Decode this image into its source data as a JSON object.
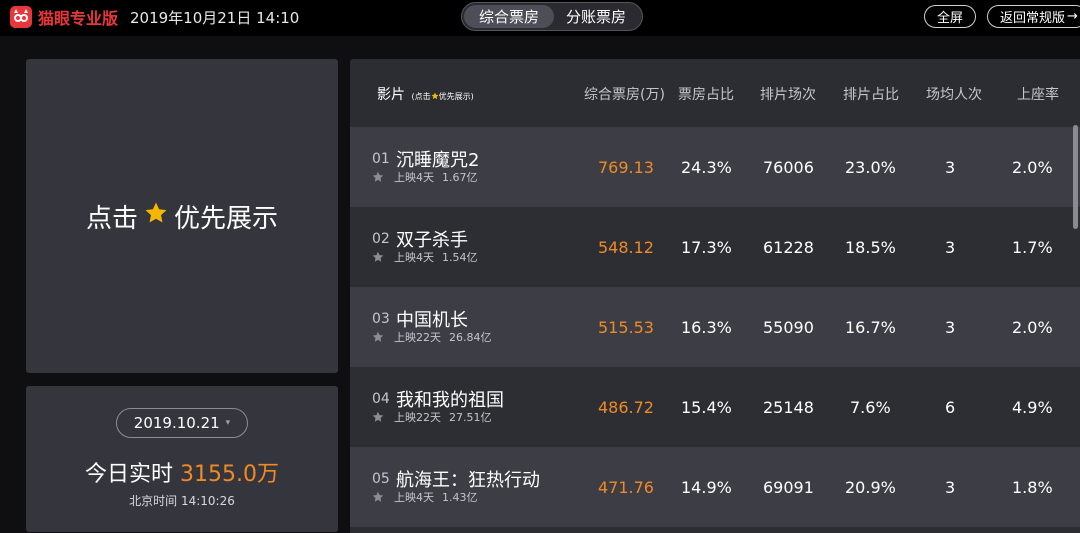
{
  "header": {
    "logo_text": "猫眼专业版",
    "datetime": "2019年10月21日 14:10",
    "tabs": [
      {
        "label": "综合票房",
        "active": true
      },
      {
        "label": "分账票房",
        "active": false
      }
    ],
    "fullscreen_label": "全屏",
    "return_label": "返回常规版",
    "return_arrow": "→"
  },
  "priority_panel": {
    "text_before": "点击",
    "text_after": "优先展示"
  },
  "today_panel": {
    "date": "2019.10.21",
    "caret": "▾",
    "label": "今日实时",
    "amount": "3155.0万",
    "beijing_time": "北京时间 14:10:26"
  },
  "table": {
    "headers": {
      "film": "影片",
      "film_hint_before": "(点击",
      "film_hint_after": "优先展示)",
      "box_office": "综合票房(万)",
      "box_share": "票房占比",
      "shows": "排片场次",
      "show_share": "排片占比",
      "avg_attendance": "场均人次",
      "occupancy": "上座率"
    },
    "rows": [
      {
        "rank": "01",
        "title": "沉睡魔咒2",
        "days": "上映4天",
        "total": "1.67亿",
        "box_office": "769.13",
        "box_share": "24.3%",
        "shows": "76006",
        "show_share": "23.0%",
        "avg_attendance": "3",
        "occupancy": "2.0%"
      },
      {
        "rank": "02",
        "title": "双子杀手",
        "days": "上映4天",
        "total": "1.54亿",
        "box_office": "548.12",
        "box_share": "17.3%",
        "shows": "61228",
        "show_share": "18.5%",
        "avg_attendance": "3",
        "occupancy": "1.7%"
      },
      {
        "rank": "03",
        "title": "中国机长",
        "days": "上映22天",
        "total": "26.84亿",
        "box_office": "515.53",
        "box_share": "16.3%",
        "shows": "55090",
        "show_share": "16.7%",
        "avg_attendance": "3",
        "occupancy": "2.0%"
      },
      {
        "rank": "04",
        "title": "我和我的祖国",
        "days": "上映22天",
        "total": "27.51亿",
        "box_office": "486.72",
        "box_share": "15.4%",
        "shows": "25148",
        "show_share": "7.6%",
        "avg_attendance": "6",
        "occupancy": "4.9%"
      },
      {
        "rank": "05",
        "title": "航海王：狂热行动",
        "days": "上映4天",
        "total": "1.43亿",
        "box_office": "471.76",
        "box_share": "14.9%",
        "shows": "69091",
        "show_share": "20.9%",
        "avg_attendance": "3",
        "occupancy": "1.8%"
      }
    ]
  },
  "colors": {
    "brand": "#e8373a",
    "accent": "#f08a24",
    "star": "#f5b800"
  }
}
